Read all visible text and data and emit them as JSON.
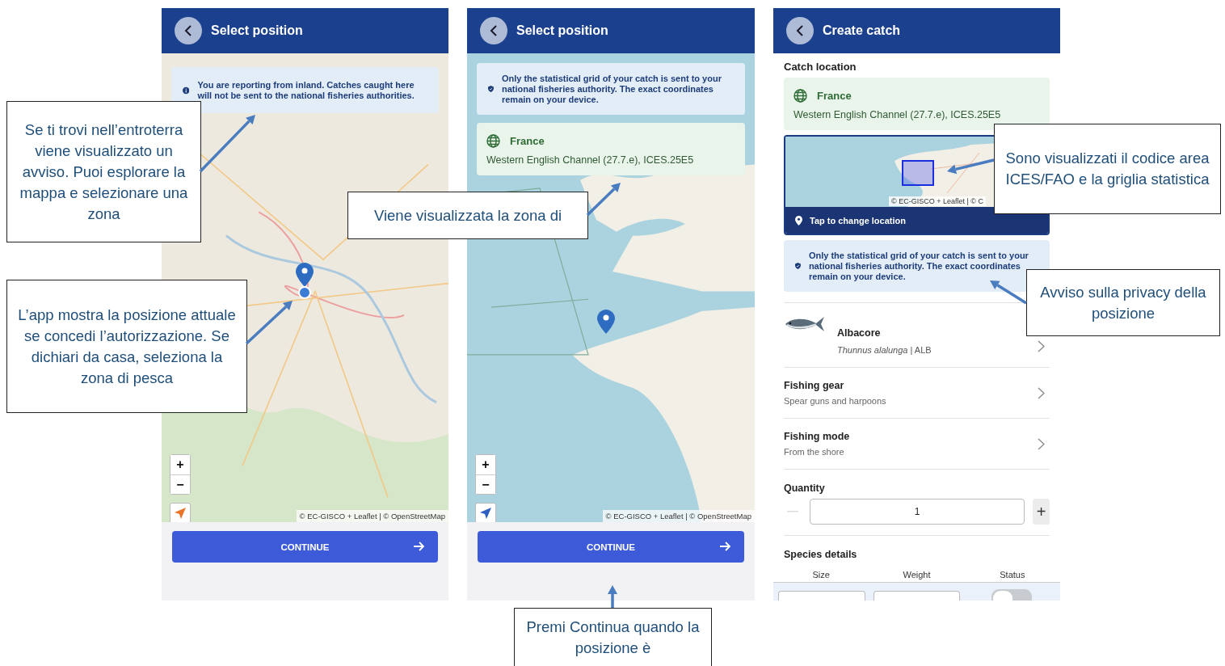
{
  "screens": [
    {
      "kind": "map",
      "title": "Select position",
      "notices": [
        {
          "kind": "info",
          "text": "You are reporting from inland. Catches caught here will not be sent to the national fisheries authorities."
        }
      ],
      "zoom_in": "+",
      "zoom_out": "−",
      "locate_active": true,
      "attribution": "© EC-GISCO + Leaflet | © OpenStreetMap",
      "button": "CONTINUE"
    },
    {
      "kind": "map",
      "title": "Select position",
      "notices": [
        {
          "kind": "privacy",
          "text": "Only the statistical grid of your catch is sent to your national fisheries authority. The exact coordinates remain on your device."
        }
      ],
      "location": {
        "country": "France",
        "area": "Western English Channel (27.7.e), ICES.25E5"
      },
      "zoom_in": "+",
      "zoom_out": "−",
      "locate_active": false,
      "attribution": "© EC-GISCO + Leaflet | © OpenStreetMap",
      "button": "CONTINUE"
    },
    {
      "kind": "catch",
      "title": "Create catch",
      "section": "Catch location",
      "location": {
        "country": "France",
        "area": "Western English Channel (27.7.e), ICES.25E5"
      },
      "attribution": "© EC-GISCO + Leaflet | © C",
      "map_action": "Tap to change location",
      "notices": [
        {
          "kind": "privacy",
          "text": "Only the statistical grid of your catch is sent to your national fisheries authority. The exact coordinates remain on your device."
        }
      ],
      "species": {
        "name": "Albacore",
        "detail": "*Thunnus alalunga* | ALB"
      },
      "rows": [
        {
          "label": "Fishing gear",
          "value": "Spear guns and harpoons"
        },
        {
          "label": "Fishing mode",
          "value": "From the shore"
        }
      ],
      "quantity": {
        "label": "Quantity",
        "value": "1",
        "minus_disabled": true,
        "plus": "+"
      },
      "details": {
        "title": "Species details",
        "columns": [
          "Size",
          "Weight",
          "Status"
        ],
        "status_on": false
      }
    }
  ],
  "callouts": [
    {
      "text": "Se ti trovi nell’entroterra viene visualizzato un avviso. Puoi esplorare la mappa e selezionare una zona"
    },
    {
      "text": "L’app mostra la posizione attuale se concedi l’autorizzazione. Se dichiari da casa, seleziona la zona di pesca"
    },
    {
      "text": "Viene visualizzata la zona di"
    },
    {
      "text": "Sono visualizzati il codice area ICES/FAO e la griglia statistica"
    },
    {
      "text": "Avviso sulla privacy della posizione"
    },
    {
      "text": "Premi Continua quando la posizione è"
    }
  ]
}
